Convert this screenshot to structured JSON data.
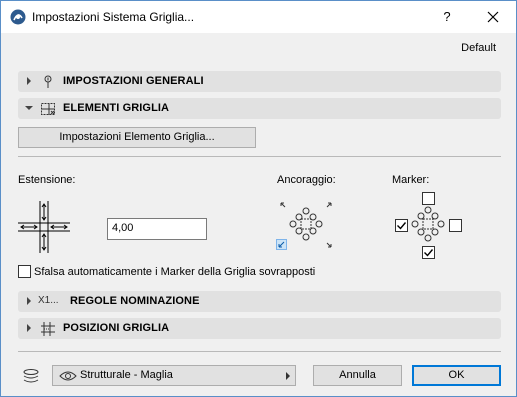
{
  "window": {
    "title": "Impostazioni Sistema Griglia...",
    "help_label": "?"
  },
  "header": {
    "default_label": "Default"
  },
  "sections": {
    "general": {
      "label": "IMPOSTAZIONI GENERALI",
      "icon": "pin-icon",
      "expanded": false
    },
    "elements": {
      "label": "ELEMENTI GRIGLIA",
      "icon": "grid-element-icon",
      "expanded": true
    },
    "naming": {
      "label": "REGOLE NOMINAZIONE",
      "icon_text": "X1...",
      "expanded": false
    },
    "positions": {
      "label": "POSIZIONI GRIGLIA",
      "icon": "grid-positions-icon",
      "expanded": false
    }
  },
  "elements": {
    "settings_button": "Impostazioni Elemento Griglia...",
    "extension_label": "Estensione:",
    "extension_value": "4,00",
    "anchor_label": "Ancoraggio:",
    "anchor_selected": "bottom-left",
    "marker_label": "Marker:",
    "markers": {
      "top": false,
      "left": true,
      "right": false,
      "bottom": true
    },
    "offset_checkbox_label": "Sfalsa automaticamente i Marker della Griglia sovrapposti",
    "offset_checked": false
  },
  "footer": {
    "layer_value": "Strutturale - Maglia",
    "cancel_label": "Annulla",
    "ok_label": "OK"
  },
  "colors": {
    "accent": "#0078d7",
    "section_bg": "#e1e1e1",
    "dialog_bg": "#f0f0f0",
    "anchor_selected": "#cce4f7"
  }
}
